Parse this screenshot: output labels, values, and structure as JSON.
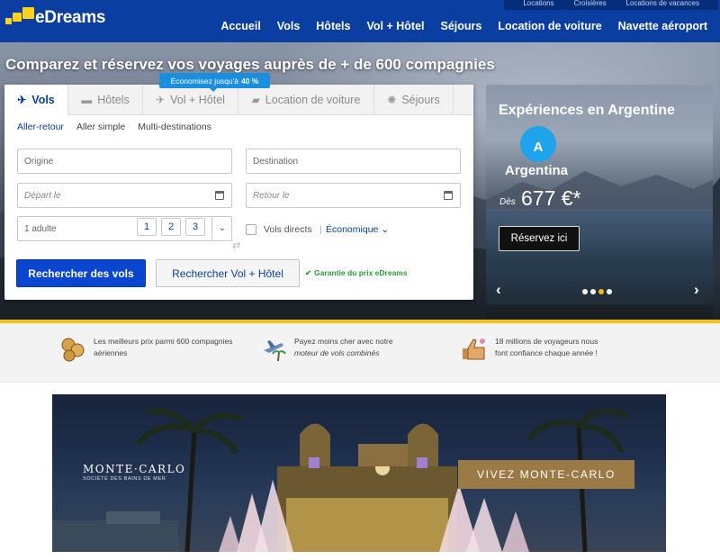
{
  "header": {
    "logo_text": "eDreams",
    "toplinks": [
      "Locations",
      "Croisières",
      "Locations de vacances"
    ],
    "nav": [
      "Accueil",
      "Vols",
      "Hôtels",
      "Vol + Hôtel",
      "Séjours",
      "Location de voiture",
      "Navette aéroport"
    ]
  },
  "hero": {
    "title": "Comparez et réservez vos voyages auprès de + de 600 compagnies"
  },
  "search": {
    "tabs": [
      {
        "label": "Vols",
        "icon": "plane-icon"
      },
      {
        "label": "Hôtels",
        "icon": "bed-icon"
      },
      {
        "label": "Vol + Hôtel",
        "icon": "plane-bed-icon"
      },
      {
        "label": "Location de voiture",
        "icon": "car-icon"
      },
      {
        "label": "Séjours",
        "icon": "sun-icon"
      }
    ],
    "promo_badge_prefix": "Économisez jusqu'à",
    "promo_badge_value": "40 %",
    "trip_types": [
      "Aller-retour",
      "Aller simple",
      "Multi-destinations"
    ],
    "origin_placeholder": "Origine",
    "destination_placeholder": "Destination",
    "depart_placeholder": "Départ le",
    "return_placeholder": "Retour le",
    "passengers_value": "1 adulte",
    "passenger_counts": [
      "1",
      "2",
      "3"
    ],
    "direct_flights_label": "Vols directs",
    "cabin_class": "Économique",
    "search_flights_button": "Rechercher des vols",
    "search_flight_hotel_button": "Rechercher Vol + Hôtel",
    "guarantee_text": "Garantie du prix eDreams"
  },
  "promo_card": {
    "title": "Expériences en Argentine",
    "badge_letter": "A",
    "country": "Argentina",
    "price_prefix": "Dès",
    "price": "677 €*",
    "cta": "Réservez ici",
    "dots": 4,
    "active_dot": 3
  },
  "benefits": [
    {
      "icon": "coins-icon",
      "text_line1": "Les meilleurs prix parmi 600 compagnies",
      "text_line2": "aériennes"
    },
    {
      "icon": "plane-palm-icon",
      "text_line1": "Payez moins cher avec notre",
      "text_emph": "moteur de vols combinés"
    },
    {
      "icon": "thumbs-up-icon",
      "text_line1": "18 millions de voyageurs nous",
      "text_line2": "font confiance chaque année !"
    }
  ],
  "banner": {
    "logo": "MONTE·CARLO",
    "logo_sub": "SOCIÉTÉ DES BAINS DE MER",
    "cta": "VIVEZ MONTE-CARLO"
  },
  "colors": {
    "brand_blue": "#0a3ea0",
    "brand_yellow": "#f4c10f",
    "button_blue": "#0a45d0",
    "success_green": "#2a9a3a",
    "badge_blue": "#1a8fe0",
    "banner_gold": "#9b7a45"
  }
}
